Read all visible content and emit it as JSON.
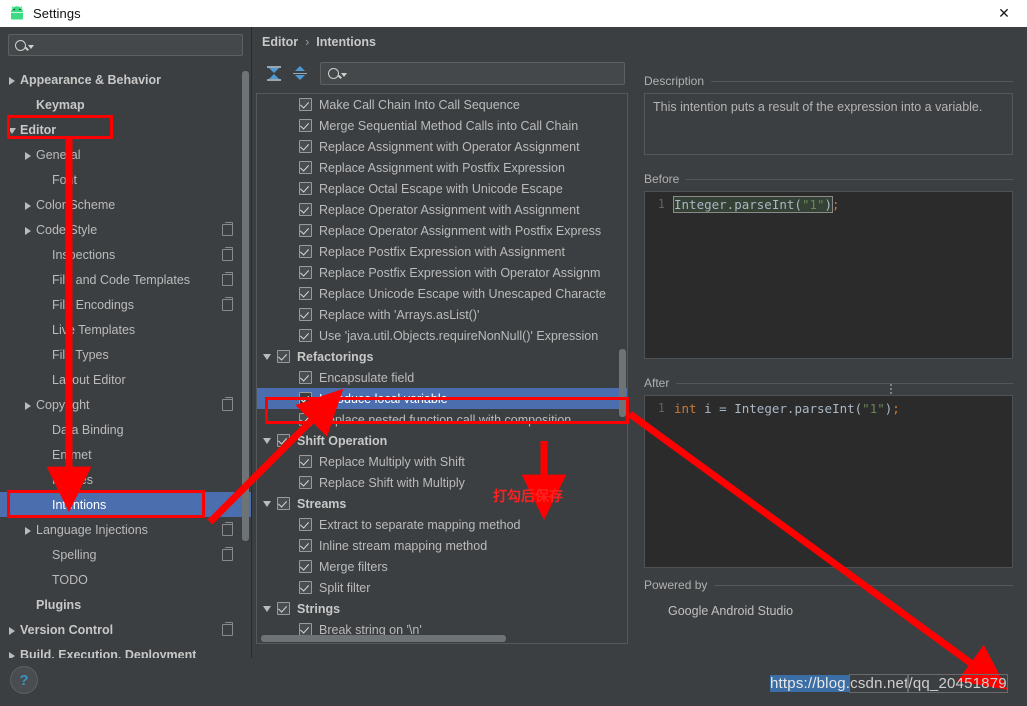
{
  "window": {
    "title": "Settings",
    "app_icon": "android-icon",
    "close_label": "✕"
  },
  "sidebar": {
    "search_placeholder": "",
    "search_value": "",
    "search_icon": "search-icon",
    "items": [
      {
        "label": "Appearance & Behavior",
        "indent": 0,
        "twisty": "right",
        "bold": true,
        "copy": false,
        "selected": false
      },
      {
        "label": "Keymap",
        "indent": 1,
        "twisty": "none",
        "bold": true,
        "copy": false,
        "selected": false
      },
      {
        "label": "Editor",
        "indent": 0,
        "twisty": "down",
        "bold": true,
        "copy": false,
        "selected": false
      },
      {
        "label": "General",
        "indent": 1,
        "twisty": "right",
        "bold": false,
        "copy": false,
        "selected": false
      },
      {
        "label": "Font",
        "indent": 2,
        "twisty": "none",
        "bold": false,
        "copy": false,
        "selected": false
      },
      {
        "label": "Color Scheme",
        "indent": 1,
        "twisty": "right",
        "bold": false,
        "copy": false,
        "selected": false
      },
      {
        "label": "Code Style",
        "indent": 1,
        "twisty": "right",
        "bold": false,
        "copy": true,
        "selected": false
      },
      {
        "label": "Inspections",
        "indent": 2,
        "twisty": "none",
        "bold": false,
        "copy": true,
        "selected": false
      },
      {
        "label": "File and Code Templates",
        "indent": 2,
        "twisty": "none",
        "bold": false,
        "copy": true,
        "selected": false
      },
      {
        "label": "File Encodings",
        "indent": 2,
        "twisty": "none",
        "bold": false,
        "copy": true,
        "selected": false
      },
      {
        "label": "Live Templates",
        "indent": 2,
        "twisty": "none",
        "bold": false,
        "copy": false,
        "selected": false
      },
      {
        "label": "File Types",
        "indent": 2,
        "twisty": "none",
        "bold": false,
        "copy": false,
        "selected": false
      },
      {
        "label": "Layout Editor",
        "indent": 2,
        "twisty": "none",
        "bold": false,
        "copy": false,
        "selected": false
      },
      {
        "label": "Copyright",
        "indent": 1,
        "twisty": "right",
        "bold": false,
        "copy": true,
        "selected": false
      },
      {
        "label": "Data Binding",
        "indent": 2,
        "twisty": "none",
        "bold": false,
        "copy": false,
        "selected": false
      },
      {
        "label": "Emmet",
        "indent": 2,
        "twisty": "none",
        "bold": false,
        "copy": false,
        "selected": false
      },
      {
        "label": "Images",
        "indent": 2,
        "twisty": "none",
        "bold": false,
        "copy": false,
        "selected": false
      },
      {
        "label": "Intentions",
        "indent": 2,
        "twisty": "none",
        "bold": false,
        "copy": false,
        "selected": true
      },
      {
        "label": "Language Injections",
        "indent": 1,
        "twisty": "right",
        "bold": false,
        "copy": true,
        "selected": false
      },
      {
        "label": "Spelling",
        "indent": 2,
        "twisty": "none",
        "bold": false,
        "copy": true,
        "selected": false
      },
      {
        "label": "TODO",
        "indent": 2,
        "twisty": "none",
        "bold": false,
        "copy": false,
        "selected": false
      },
      {
        "label": "Plugins",
        "indent": 1,
        "twisty": "none",
        "bold": true,
        "copy": false,
        "selected": false
      },
      {
        "label": "Version Control",
        "indent": 0,
        "twisty": "right",
        "bold": true,
        "copy": true,
        "selected": false
      },
      {
        "label": "Build, Execution, Deployment",
        "indent": 0,
        "twisty": "right",
        "bold": true,
        "copy": false,
        "selected": false
      }
    ]
  },
  "breadcrumb": {
    "parent": "Editor",
    "separator": "›",
    "current": "Intentions"
  },
  "toolbar": {
    "expand_all_icon": "expand-all-icon",
    "collapse_all_icon": "collapse-all-icon",
    "filter_icon": "search-icon",
    "filter_placeholder": "",
    "filter_value": ""
  },
  "intentions": [
    {
      "label": "Make Call Chain Into Call Sequence",
      "checked": true,
      "level": 2,
      "group": false,
      "selected": false
    },
    {
      "label": "Merge Sequential Method Calls into Call Chain",
      "checked": true,
      "level": 2,
      "group": false,
      "selected": false
    },
    {
      "label": "Replace Assignment with Operator Assignment",
      "checked": true,
      "level": 2,
      "group": false,
      "selected": false
    },
    {
      "label": "Replace Assignment with Postfix Expression",
      "checked": true,
      "level": 2,
      "group": false,
      "selected": false
    },
    {
      "label": "Replace Octal Escape with Unicode Escape",
      "checked": true,
      "level": 2,
      "group": false,
      "selected": false
    },
    {
      "label": "Replace Operator Assignment with Assignment",
      "checked": true,
      "level": 2,
      "group": false,
      "selected": false
    },
    {
      "label": "Replace Operator Assignment with Postfix Express",
      "checked": true,
      "level": 2,
      "group": false,
      "selected": false
    },
    {
      "label": "Replace Postfix Expression with Assignment",
      "checked": true,
      "level": 2,
      "group": false,
      "selected": false
    },
    {
      "label": "Replace Postfix Expression with Operator Assignm",
      "checked": true,
      "level": 2,
      "group": false,
      "selected": false
    },
    {
      "label": "Replace Unicode Escape with Unescaped Characte",
      "checked": true,
      "level": 2,
      "group": false,
      "selected": false
    },
    {
      "label": "Replace with 'Arrays.asList()'",
      "checked": true,
      "level": 2,
      "group": false,
      "selected": false
    },
    {
      "label": "Use 'java.util.Objects.requireNonNull()' Expression",
      "checked": true,
      "level": 2,
      "group": false,
      "selected": false
    },
    {
      "label": "Refactorings",
      "checked": true,
      "level": 1,
      "group": true,
      "selected": false
    },
    {
      "label": "Encapsulate field",
      "checked": true,
      "level": 2,
      "group": false,
      "selected": false
    },
    {
      "label": "Introduce local variable",
      "checked": true,
      "level": 2,
      "group": false,
      "selected": true
    },
    {
      "label": "Replace nested function call with composition",
      "checked": true,
      "level": 2,
      "group": false,
      "selected": false
    },
    {
      "label": "Shift Operation",
      "checked": true,
      "level": 1,
      "group": true,
      "selected": false
    },
    {
      "label": "Replace Multiply with Shift",
      "checked": true,
      "level": 2,
      "group": false,
      "selected": false
    },
    {
      "label": "Replace Shift with Multiply",
      "checked": true,
      "level": 2,
      "group": false,
      "selected": false
    },
    {
      "label": "Streams",
      "checked": true,
      "level": 1,
      "group": true,
      "selected": false
    },
    {
      "label": "Extract to separate mapping method",
      "checked": true,
      "level": 2,
      "group": false,
      "selected": false
    },
    {
      "label": "Inline stream mapping method",
      "checked": true,
      "level": 2,
      "group": false,
      "selected": false
    },
    {
      "label": "Merge filters",
      "checked": true,
      "level": 2,
      "group": false,
      "selected": false
    },
    {
      "label": "Split filter",
      "checked": true,
      "level": 2,
      "group": false,
      "selected": false
    },
    {
      "label": "Strings",
      "checked": true,
      "level": 1,
      "group": true,
      "selected": false
    },
    {
      "label": "Break string on '\\n'",
      "checked": true,
      "level": 2,
      "group": false,
      "selected": false
    }
  ],
  "details": {
    "description_title": "Description",
    "description_text": "This intention puts a result of the expression into a variable.",
    "before_title": "Before",
    "before_line_no": "1",
    "before_code": {
      "cls": "Integer.parseInt(",
      "str": "\"1\"",
      "close": ")",
      "semi": ";"
    },
    "after_title": "After",
    "after_line_no": "1",
    "after_code": {
      "kw": "int",
      "var": "i",
      "eq": "=",
      "cls": "Integer.parseInt(",
      "str": "\"1\"",
      "close": ")",
      "semi": ";"
    },
    "powered_title": "Powered by",
    "powered_value": "Google Android Studio"
  },
  "annotations": {
    "note_text": "打勾后保存",
    "boxes": [
      "editor-sidebar-box",
      "intentions-sidebar-box",
      "introduce-local-variable-box"
    ]
  },
  "watermark": {
    "part1": "https://blog.",
    "part2": "csdn.net",
    "part3": "/qq_20451879"
  },
  "help": {
    "label": "?"
  },
  "colors": {
    "selection_blue": "#4b6eaf",
    "annotation_red": "#ff0000",
    "panel_bg": "#3c3f41",
    "code_bg": "#2b2b2b",
    "accent_blue": "#4e9ad4"
  }
}
